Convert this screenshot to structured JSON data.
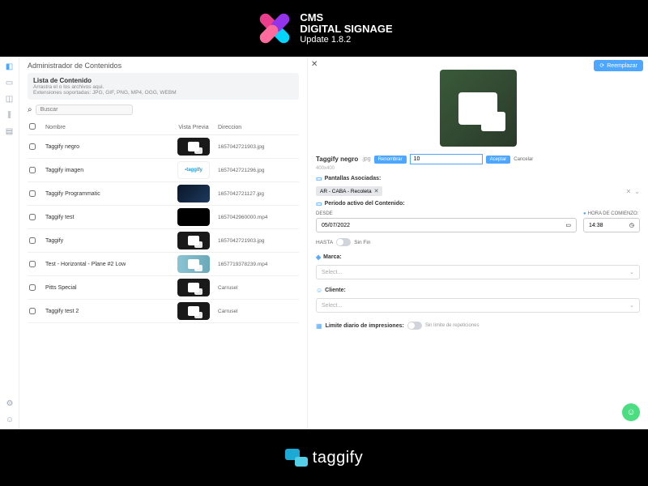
{
  "banner": {
    "line1": "CMS",
    "line2": "DIGITAL SIGNAGE",
    "line3": "Update 1.8.2"
  },
  "app": {
    "title": "Administrador de Contenidos",
    "upload_title": "Lista de Contenido",
    "upload_hint": "Arrastra el o los archivos aqui.",
    "upload_formats": "Extensiones soportadas: JPG, GIF, PNG, MP4, OGG, WEBM",
    "search_placeholder": "Buscar",
    "cols": {
      "name": "Nombre",
      "preview": "Vista Previa",
      "dir": "Direccion"
    },
    "rows": [
      {
        "name": "Taggify negro",
        "dir": "1657042721903.jpg",
        "thumb": "black-overlap"
      },
      {
        "name": "Taggify imagen",
        "dir": "1657042721296.jpg",
        "thumb": "taggify"
      },
      {
        "name": "Taggify Programmatic",
        "dir": "1657042721127.jpg",
        "thumb": "prog"
      },
      {
        "name": "Taggify test",
        "dir": "1657042960000.mp4",
        "thumb": "black"
      },
      {
        "name": "Taggify",
        "dir": "1657042721903.jpg",
        "thumb": "black-overlap"
      },
      {
        "name": "Test - Horizontal - Plane #2 Low",
        "dir": "1657719378239.mp4",
        "thumb": "plane"
      },
      {
        "name": "Pitts Special",
        "dir": "Carrusel",
        "thumb": "black-overlap"
      },
      {
        "name": "Taggify test 2",
        "dir": "Carrusel",
        "thumb": "black-overlap"
      }
    ]
  },
  "detail": {
    "replace": "Reemplazar",
    "name": "Taggify negro",
    "ext": ".jpg",
    "resolution": "400x400",
    "rename": "Renombrar",
    "duration": "10",
    "accept": "Aceptar",
    "cancel": "Cancelar",
    "screens_label": "Pantallas Asociadas:",
    "screen_chip": "AR - CABA - Recoleta",
    "period_label": "Periodo activo del Contenido:",
    "desde": "DESDE",
    "date_value": "05/07/2022",
    "hora_label": "HORA DE COMIENZO:",
    "time_value": "14:38",
    "hasta": "HASTA",
    "sin_fin": "Sin Fin",
    "marca": "Marca:",
    "cliente": "Cliente:",
    "select_placeholder": "Select...",
    "limit_label": "Limite diario de impresiones:",
    "limit_hint": "Sin limite de repeticiones"
  },
  "footer": {
    "brand": "taggify"
  }
}
